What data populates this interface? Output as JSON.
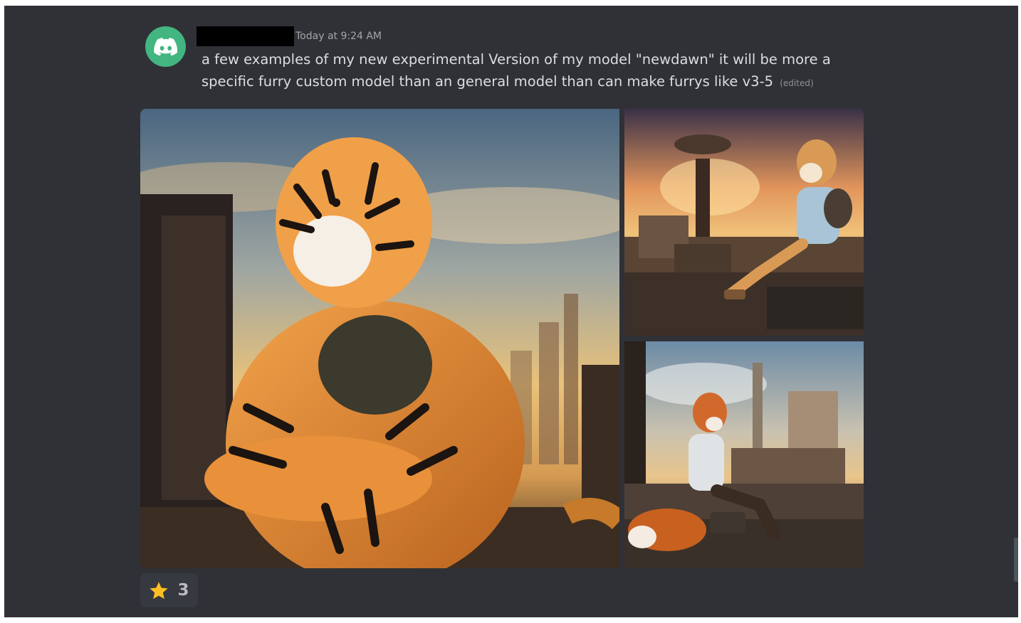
{
  "message": {
    "author_redacted": true,
    "timestamp": "Today at 9:24 AM",
    "text": "a few examples of my new experimental Version of my model \"newdawn\" it will be more a specific furry custom model than an general model than can make furrys like v3-5",
    "edited_label": "(edited)"
  },
  "avatar": {
    "icon": "discord-logo-icon",
    "color": "#43b581"
  },
  "attachments": [
    {
      "subject": "tiger character in ruined city"
    },
    {
      "subject": "shiba character on rooftop"
    },
    {
      "subject": "fox character on ledge"
    }
  ],
  "reactions": [
    {
      "emoji": "star-icon",
      "count": "3"
    }
  ],
  "colors": {
    "background": "#2f3136",
    "text": "#dcddde",
    "muted": "#a3a6aa",
    "accent_star": "#fbbf24"
  }
}
